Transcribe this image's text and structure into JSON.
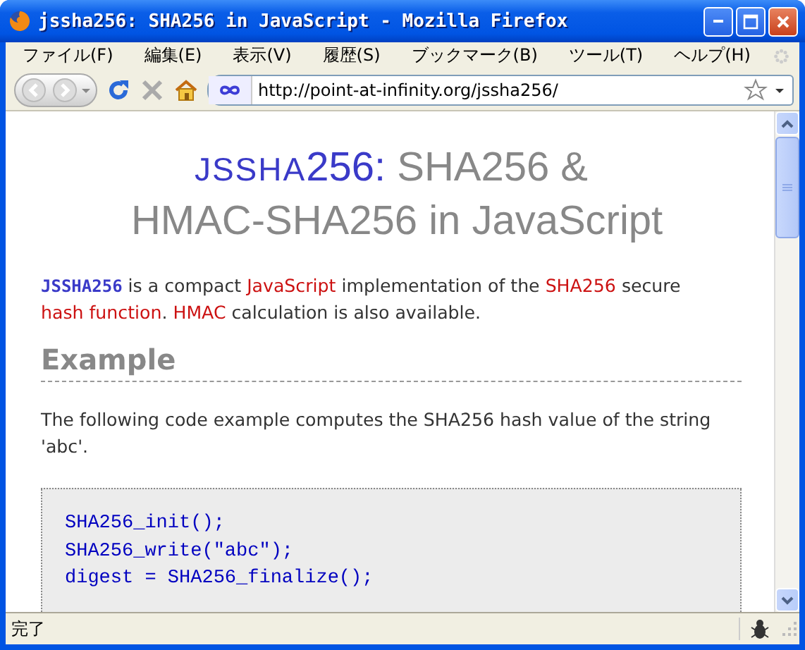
{
  "window": {
    "title": "jssha256: SHA256 in JavaScript - Mozilla Firefox"
  },
  "menu": [
    "ファイル(F)",
    "編集(E)",
    "表示(V)",
    "履歴(S)",
    "ブックマーク(B)",
    "ツール(T)",
    "ヘルプ(H)"
  ],
  "address_bar": {
    "value": "http://point-at-infinity.org/jssha256/"
  },
  "page": {
    "title": [
      {
        "text": "JSSHA",
        "kind": "brand-small"
      },
      {
        "text": "256:",
        "kind": "brand"
      },
      {
        "text": " SHA256 &",
        "kind": "plain"
      },
      {
        "text": " HMAC-SHA256 in JavaScript",
        "kind": "plain"
      }
    ],
    "intro": [
      {
        "text": "JSSHA256",
        "kind": "brand"
      },
      {
        "text": " is a compact ",
        "kind": "plain"
      },
      {
        "text": "JavaScript",
        "kind": "link"
      },
      {
        "text": " implementation of the ",
        "kind": "plain"
      },
      {
        "text": "SHA256",
        "kind": "link"
      },
      {
        "text": " secure ",
        "kind": "plain"
      },
      {
        "text": "hash function",
        "kind": "link"
      },
      {
        "text": ". ",
        "kind": "plain"
      },
      {
        "text": "HMAC",
        "kind": "link"
      },
      {
        "text": " calculation is also available.",
        "kind": "plain"
      }
    ],
    "heading": "Example",
    "description": "The following code example computes the SHA256 hash value of the string 'abc'.",
    "code": [
      "SHA256_init();",
      "SHA256_write(\"abc\");",
      "digest = SHA256_finalize();"
    ]
  },
  "status_bar": {
    "text": "完了"
  }
}
